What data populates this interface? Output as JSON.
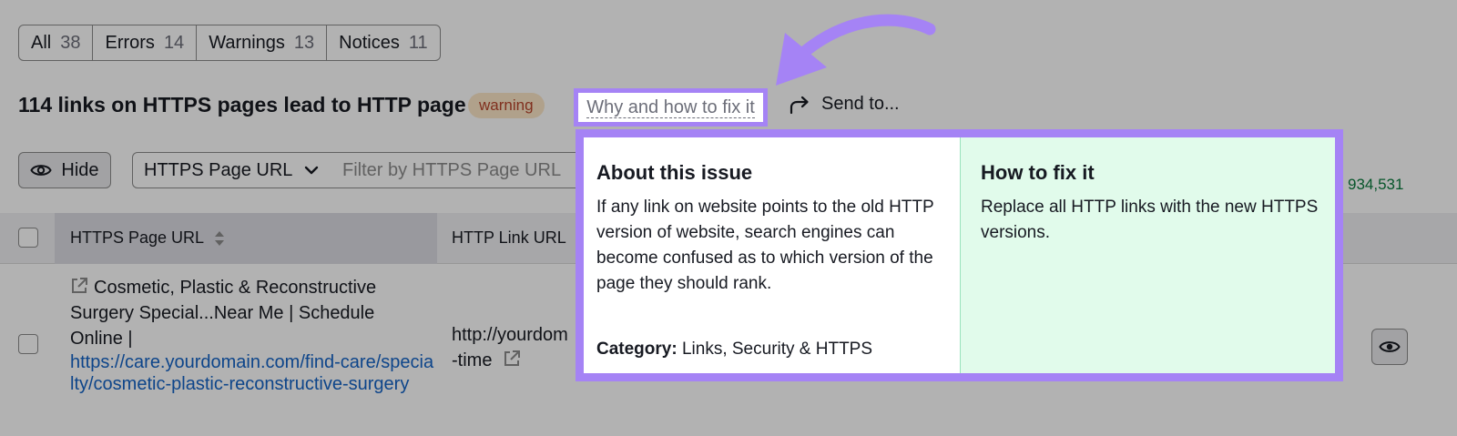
{
  "filter_tabs": [
    {
      "label": "All",
      "count": "38"
    },
    {
      "label": "Errors",
      "count": "14"
    },
    {
      "label": "Warnings",
      "count": "13"
    },
    {
      "label": "Notices",
      "count": "11"
    }
  ],
  "issue": {
    "title": "114 links on HTTPS pages lead to HTTP page",
    "badge": "warning",
    "why_link": "Why and how to fix it",
    "send_to": "Send to..."
  },
  "toolbar": {
    "hide_label": "Hide",
    "select_value": "HTTPS Page URL",
    "filter_placeholder": "Filter by HTTPS Page URL",
    "total_count": "934,531"
  },
  "table": {
    "columns": [
      "HTTPS Page URL",
      "HTTP Link URL"
    ],
    "rows": [
      {
        "page_title": "Cosmetic, Plastic & Reconstructive Surgery Special...Near Me | Schedule Online |",
        "page_url": "https://care.yourdomain.com/find-care/specialty/cosmetic-plastic-reconstructive-surgery",
        "http_link_line1": "http://yourdom",
        "http_link_line2": "-time"
      }
    ]
  },
  "popup": {
    "about_title": "About this issue",
    "about_text": "If any link on website points to the old HTTP version of website, search engines can become confused as to which version of the page they should rank.",
    "category_label": "Category:",
    "category_value": "Links, Security & HTTPS",
    "fix_title": "How to fix it",
    "fix_text": "Replace all HTTP links with the new HTTPS versions."
  },
  "colors": {
    "highlight": "#a583f5",
    "badge_bg": "#fde7c8",
    "badge_text": "#b8452c",
    "fix_bg": "#e1fbeb",
    "link": "#1463c6"
  },
  "icons": [
    "share-arrow-icon",
    "eye-icon",
    "chevron-down-icon",
    "sort-icon",
    "external-link-icon",
    "annotation-arrow-icon"
  ]
}
